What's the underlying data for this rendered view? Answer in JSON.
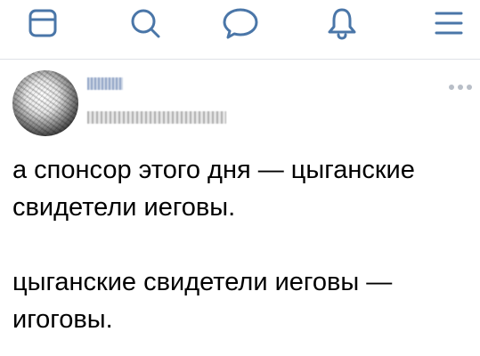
{
  "nav": {
    "items": [
      {
        "icon": "news-icon"
      },
      {
        "icon": "search-icon"
      },
      {
        "icon": "messages-icon"
      },
      {
        "icon": "notifications-icon"
      },
      {
        "icon": "menu-icon"
      }
    ],
    "accent": "#4a76a8"
  },
  "post": {
    "more_icon": "more-icon",
    "paragraphs": [
      "а спонсор этого дня — цыганские свидетели иеговы.",
      "цыганские свидетели иеговы — игоговы."
    ]
  }
}
